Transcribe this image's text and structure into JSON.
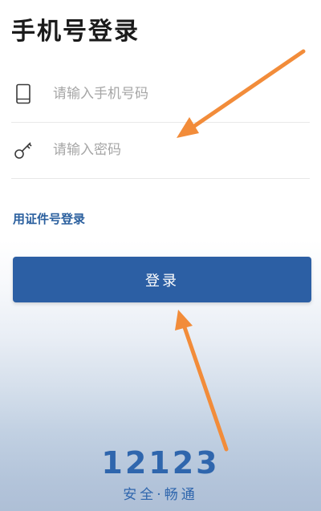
{
  "header": {
    "title": "手机号登录"
  },
  "form": {
    "phone": {
      "placeholder": "请输入手机号码",
      "value": "",
      "icon": "phone-icon"
    },
    "password": {
      "placeholder": "请输入密码",
      "value": "",
      "icon": "key-icon"
    },
    "alt_login_label": "用证件号登录",
    "submit_label": "登录"
  },
  "branding": {
    "number": "12123",
    "slogan": "安全·畅通"
  },
  "colors": {
    "accent": "#2c5fa4",
    "link": "#2a5f9e",
    "annotation_arrow": "#f28c3a"
  }
}
